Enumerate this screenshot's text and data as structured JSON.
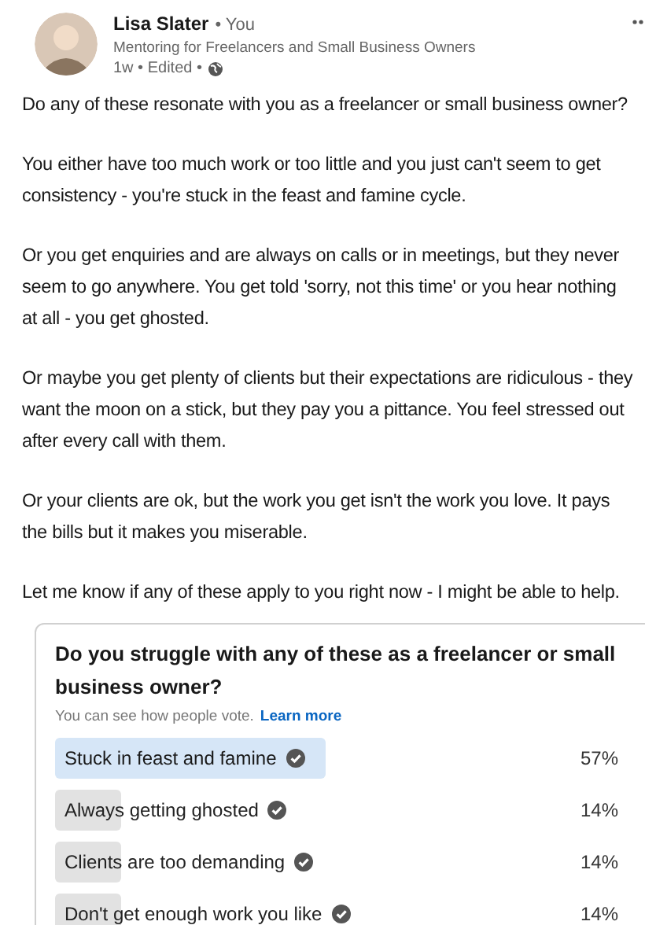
{
  "author": {
    "name": "Lisa Slater",
    "relation": "• You",
    "headline": "Mentoring for Freelancers and Small Business Owners",
    "meta": "1w • Edited •"
  },
  "post_text": [
    "Do any of these resonate with you as a freelancer or small business owner?",
    "You either have too much work or too little and you just can't seem to get consistency - you're stuck in the feast and famine cycle.",
    "Or you get enquiries and are always on calls or in meetings, but they never seem to go anywhere. You get told 'sorry, not this time' or you hear nothing at all - you get ghosted.",
    "Or maybe you get plenty of clients but their expectations are ridiculous - they want the moon on a stick, but they pay you a pittance. You feel stressed out after every call with them.",
    "Or your clients are ok, but the work you get isn't the work you love. It pays the bills but it makes you miserable.",
    "Let me know if any of these apply to you right now - I might be able to help."
  ],
  "poll": {
    "question": "Do you struggle with any of these as a freelancer or small business owner?",
    "note": "You can see how people vote.",
    "link": "Learn more",
    "options": [
      {
        "label": "Stuck in feast and famine",
        "percent": "57%",
        "level": 0.57,
        "selected": true
      },
      {
        "label": "Always getting ghosted",
        "percent": "14%",
        "level": 0.14,
        "selected": false
      },
      {
        "label": "Clients are too demanding",
        "percent": "14%",
        "level": 0.14,
        "selected": false
      },
      {
        "label": "Don't get enough work you like",
        "percent": "14%",
        "level": 0.14,
        "selected": false
      }
    ]
  }
}
